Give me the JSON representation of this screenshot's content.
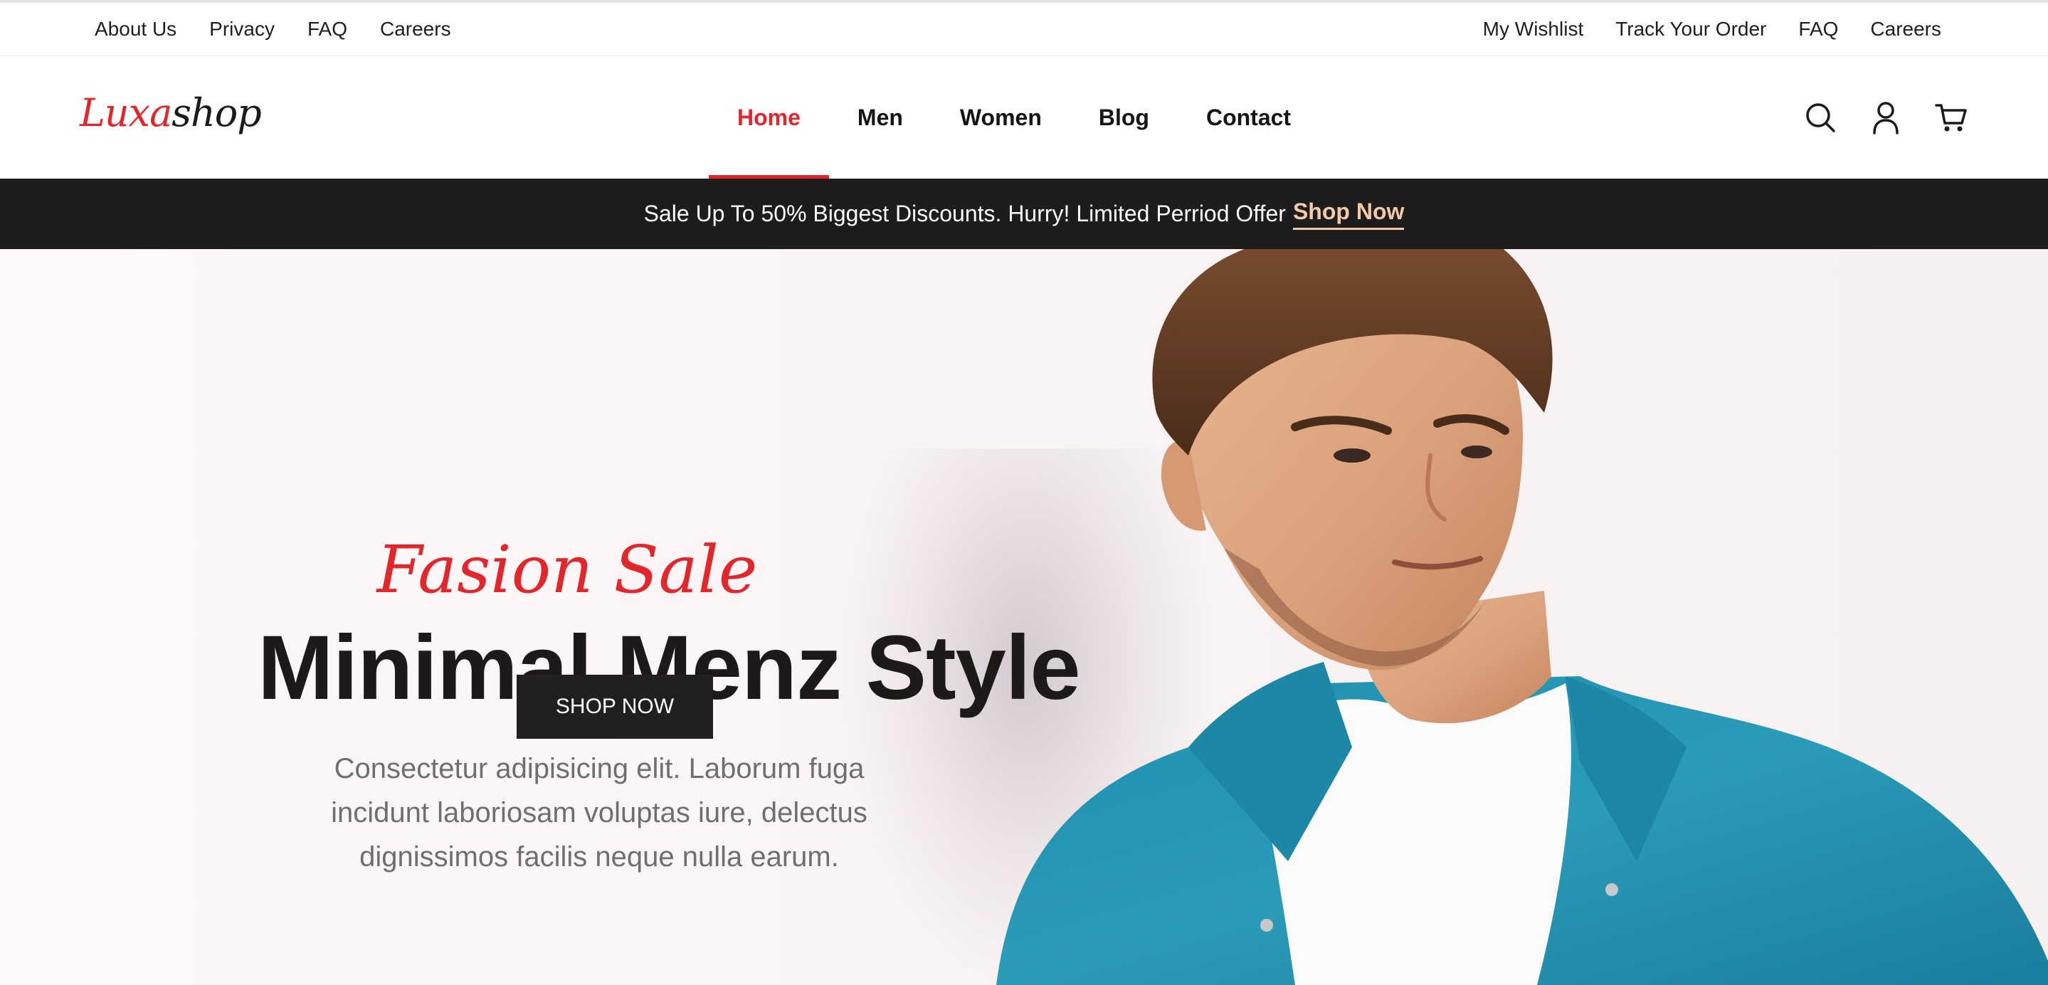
{
  "topbar": {
    "left_links": [
      "About Us",
      "Privacy",
      "FAQ",
      "Careers"
    ],
    "right_links": [
      "My Wishlist",
      "Track Your Order",
      "FAQ",
      "Careers"
    ]
  },
  "header": {
    "logo_part1": "Luxa",
    "logo_part2": "shop",
    "nav": [
      "Home",
      "Men",
      "Women",
      "Blog",
      "Contact"
    ],
    "active_nav": "Home",
    "icons": [
      "search-icon",
      "user-icon",
      "cart-icon"
    ]
  },
  "promo": {
    "text": "Sale Up To 50% Biggest Discounts. Hurry! Limited Perriod Offer",
    "cta": "Shop Now"
  },
  "hero": {
    "script": "Fasion Sale",
    "title": "Minimal Menz Style",
    "description": "Consectetur adipisicing elit. Laborum fuga incidunt laboriosam voluptas iure, delectus dignissimos facilis neque nulla earum.",
    "button": "SHOP NOW"
  },
  "colors": {
    "accent": "#e3262c",
    "dark": "#1d1d1d",
    "promo_cta": "#f3c9a7",
    "shirt": "#2a9bb8"
  }
}
